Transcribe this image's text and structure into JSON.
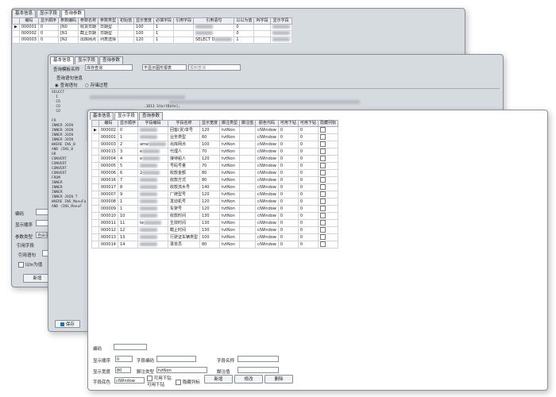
{
  "win1": {
    "tabs": [
      "基本信息",
      "显示字段",
      "查询参数"
    ],
    "active_tab": 2,
    "columns": [
      "编码",
      "显示顺序",
      "参数编码",
      "参数名称",
      "参数类型",
      "初始值",
      "显示宽度",
      "必填字段",
      "引用字段",
      "引用语句",
      "以以为值",
      "IN字段",
      "显示字段"
    ],
    "rows": [
      [
        "000001",
        "0",
        "[N0",
        "收货日期",
        "日期型",
        "",
        "100",
        "1",
        "",
        "",
        "0",
        "",
        ""
      ],
      [
        "000002",
        "0",
        "[N1",
        "截止日期",
        "日期型",
        "",
        "100",
        "1",
        "",
        "",
        "0",
        "",
        ""
      ],
      [
        "000003",
        "0",
        "[N2",
        "出库网点",
        "列表选择",
        "",
        "120",
        "1",
        "",
        "SELECT D",
        "1",
        "",
        ""
      ]
    ],
    "form": {
      "code_label": "编码",
      "order_label": "显示顺序",
      "type_label": "参数类型",
      "type_value": "自由录",
      "ref_field_label": "引用字段",
      "ref_sql_label": "引用语句",
      "in_value_label": "以In为值",
      "add_label": "新增"
    }
  },
  "win2": {
    "tabs": [
      "基本信息",
      "显示字段",
      "查询参数"
    ],
    "active_tab": 0,
    "query_name_label": "查询模板名称",
    "query_name_value": "库存查询",
    "display_mode": "不显示图形报表",
    "display_mode_2": "报到查询",
    "source_label": "查询语句信息",
    "radio_sql": "查询语句",
    "radio_proc": "存储过程",
    "sql_lines": [
      "SELECT ",
      "  I       ",
      "  CO",
      "  CO",
      "  CO",
      "  ",
      "FR",
      "INNER JOIN",
      "INNER JOIN",
      "INNER JOIN",
      "INNER JOIN",
      "WHERE INS_B",
      "AND (INS_B",
      "GR",
      "CONVERT",
      "CONVERT",
      "CONVERT",
      "CONVERT",
      "FROM",
      "INNER",
      "INNER",
      "INNER",
      "INNER JOIN T",
      "WHERE INS_ManuFa",
      "AND (INS_ManuF"
    ],
    "sql_fragment": ".1013 StartDate],",
    "save_label": "保存"
  },
  "win3": {
    "tabs": [
      "基本信息",
      "显示字段",
      "查询参数"
    ],
    "active_tab": 1,
    "columns": [
      "编码",
      "显示顺序",
      "字段编码",
      "字段名称",
      "显示宽度",
      "脚注类型",
      "脚注值",
      "颜色代码",
      "可用下钻",
      "可用下钻",
      "隐藏列标"
    ],
    "rows": [
      [
        "000002",
        "0",
        "",
        "回客(货)单号",
        "120",
        "tvtNon",
        "",
        "clWindow",
        "0",
        "0"
      ],
      [
        "000001",
        "1",
        "",
        "业务类型",
        "60",
        "tvtNon",
        "",
        "clWindow",
        "0",
        "0"
      ],
      [
        "000003",
        "2",
        "ame",
        "出库网点",
        "100",
        "tvtNon",
        "",
        "clWindow",
        "0",
        "0"
      ],
      [
        "000015",
        "3",
        "e",
        "代理人",
        "70",
        "tvtNon",
        "",
        "clWindow",
        "0",
        "0"
      ],
      [
        "000004",
        "4",
        "e",
        "接待船人",
        "120",
        "tvtNon",
        "",
        "clWindow",
        "0",
        "0"
      ],
      [
        "000005",
        "5",
        "",
        "号码号量",
        "70",
        "tvtNon",
        "",
        "clWindow",
        "0",
        "0"
      ],
      [
        "000006",
        "6",
        "2",
        "收款金额",
        "80",
        "tvtNon",
        "",
        "clWindow",
        "0",
        "0"
      ],
      [
        "000016",
        "7",
        "",
        "收款方式",
        "80",
        "tvtNon",
        "",
        "clWindow",
        "0",
        "0"
      ],
      [
        "000017",
        "8",
        "",
        "收款流水号",
        "140",
        "tvtNon",
        "",
        "clWindow",
        "0",
        "0"
      ],
      [
        "000007",
        "9",
        "",
        "厂牌型号",
        "120",
        "tvtNon",
        "",
        "clWindow",
        "0",
        "0"
      ],
      [
        "000008",
        "1",
        "",
        "发动机号",
        "120",
        "tvtNon",
        "",
        "clWindow",
        "0",
        "0"
      ],
      [
        "000009",
        "1",
        "",
        "车架号",
        "120",
        "tvtNon",
        "",
        "clWindow",
        "0",
        "0"
      ],
      [
        "000010",
        "10",
        "",
        "收款时间",
        "130",
        "tvtNon",
        "",
        "clWindow",
        "0",
        "0"
      ],
      [
        "000011",
        "11",
        "te",
        "生效时间",
        "130",
        "tvtNon",
        "",
        "clWindow",
        "0",
        "0"
      ],
      [
        "000012",
        "12",
        "",
        "截止时间",
        "130",
        "tvtNon",
        "",
        "clWindow",
        "0",
        "0"
      ],
      [
        "000013",
        "13",
        "",
        "行驶证车辆类型",
        "100",
        "tvtNon",
        "",
        "clWindow",
        "0",
        "0"
      ],
      [
        "000014",
        "14",
        "",
        "录单员",
        "80",
        "tvtNon",
        "",
        "clWindow",
        "0",
        "0"
      ]
    ],
    "form": {
      "code_label": "编码",
      "order_label": "显示顺序",
      "order_value": "0",
      "field_code_label": "字段编码",
      "field_name_label": "字段名称",
      "width_label": "显示宽度",
      "width_value": "80",
      "footer_type_label": "脚注类型",
      "footer_type_value": "tvtNon",
      "footer_value_label": "脚注值",
      "color_label": "字段底色",
      "color_value": "clWindow",
      "drill1_label": "可用下钻",
      "drill2_label": "可用下钻",
      "hide_label": "隐藏列标",
      "add_label": "新增",
      "edit_label": "修改",
      "delete_label": "删除"
    }
  }
}
